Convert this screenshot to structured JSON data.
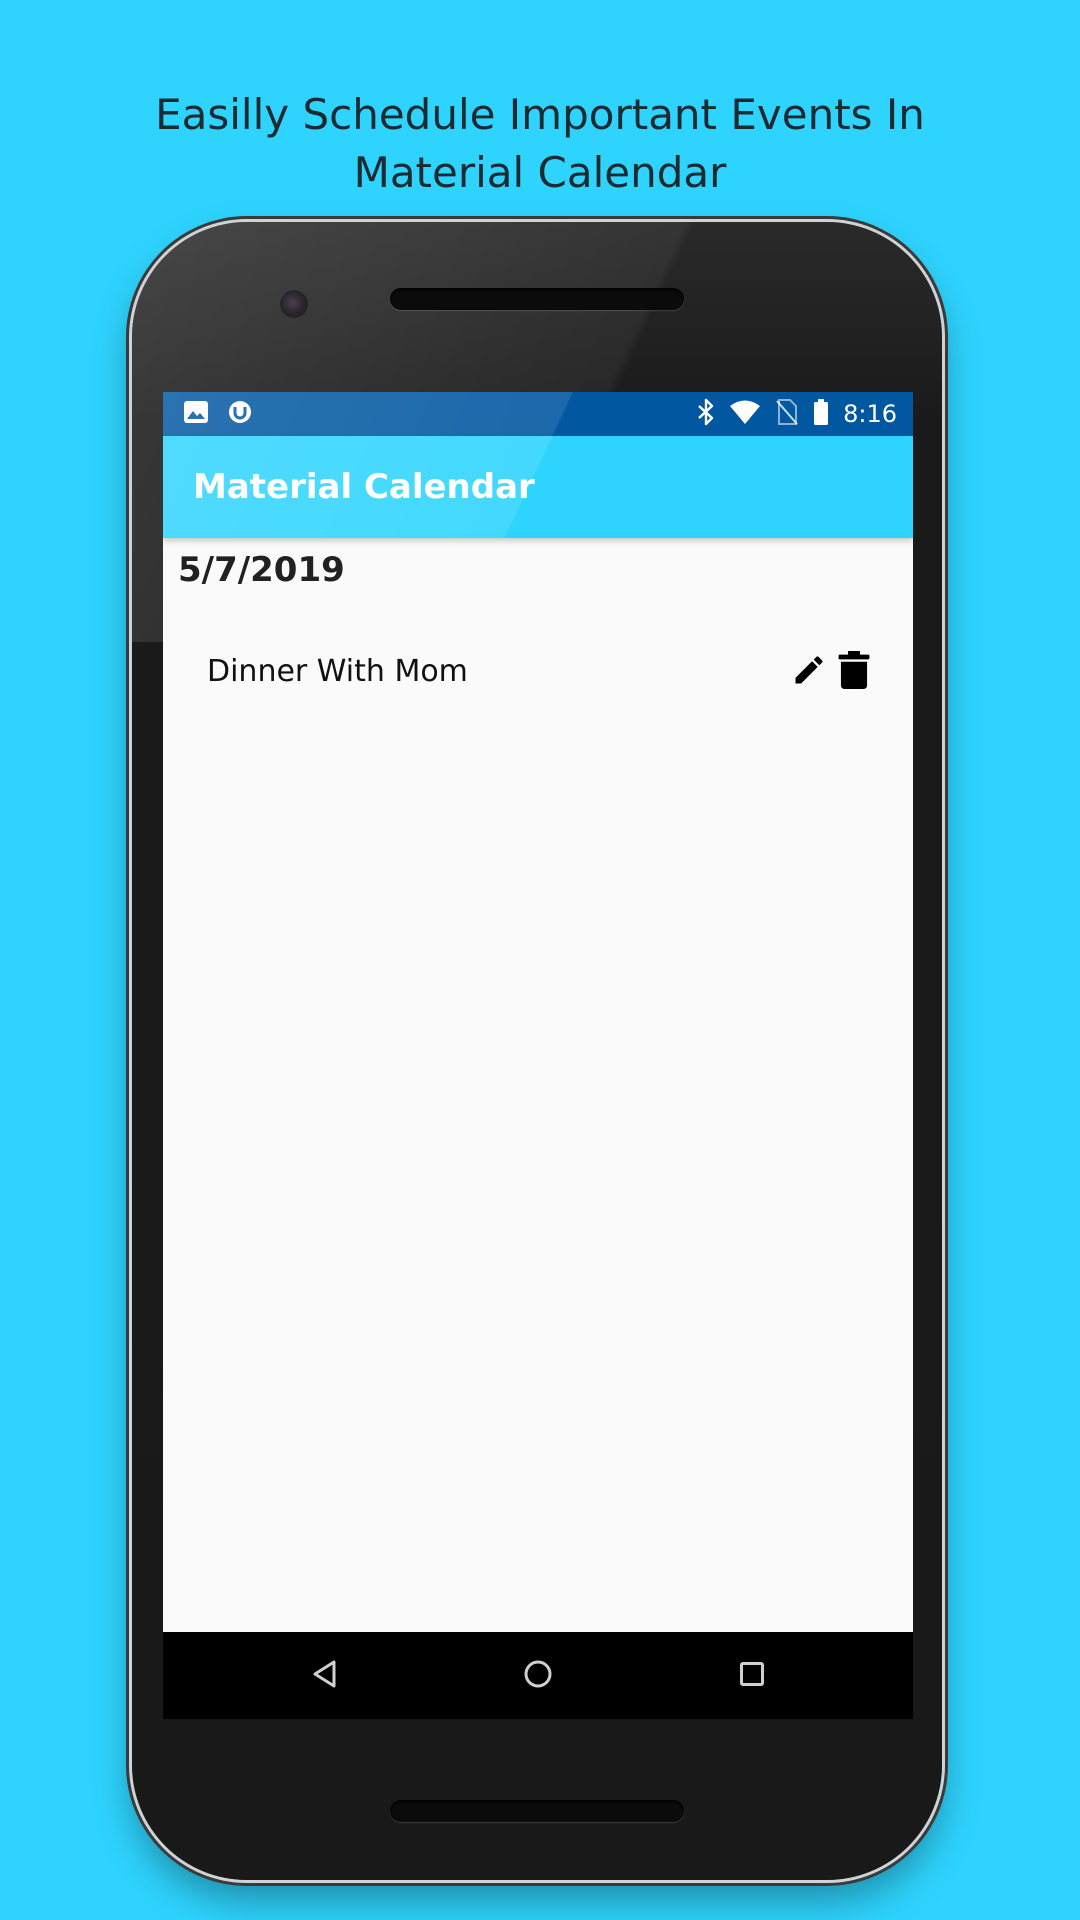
{
  "promo": {
    "headline_line1": "Easilly Schedule Important Events In",
    "headline_line2": "Material Calendar"
  },
  "statusbar": {
    "time": "8:16",
    "left_icons": [
      "image-icon",
      "app-notification-icon"
    ],
    "right_icons": [
      "bluetooth-icon",
      "wifi-icon",
      "no-sim-icon",
      "battery-icon"
    ]
  },
  "appbar": {
    "title": "Material Calendar"
  },
  "content": {
    "date": "5/7/2019",
    "events": [
      {
        "title": "Dinner With Mom",
        "actions": [
          "edit-icon",
          "delete-icon"
        ]
      }
    ]
  },
  "navbar": {
    "buttons": [
      "back-icon",
      "home-icon",
      "recents-icon"
    ]
  },
  "colors": {
    "background": "#2ED4FE",
    "statusbar": "#0257A1",
    "appbar": "#2ED4FE",
    "screen": "#FAFAFA",
    "text_primary": "#212121"
  }
}
